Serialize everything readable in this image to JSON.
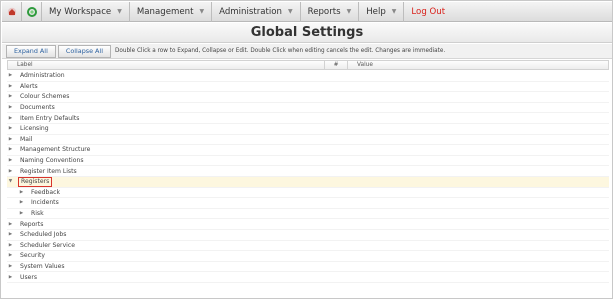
{
  "nav": {
    "items": [
      {
        "label": "My Workspace",
        "dropdown": true
      },
      {
        "label": "Management",
        "dropdown": true
      },
      {
        "label": "Administration",
        "dropdown": true
      },
      {
        "label": "Reports",
        "dropdown": true
      },
      {
        "label": "Help",
        "dropdown": true
      }
    ],
    "logout": "Log Out",
    "logout_color": "#d9211b"
  },
  "page": {
    "title": "Global Settings"
  },
  "toolbar": {
    "expand_label": "Expand All",
    "collapse_label": "Collapse All",
    "help_text": "Double Click a row to Expand, Collapse or Edit. Double Click when editing cancels the edit. Changes are immediate."
  },
  "grid": {
    "columns": [
      "Label",
      "#",
      "Value"
    ],
    "rows": [
      {
        "label": "Administration",
        "expanded": false
      },
      {
        "label": "Alerts",
        "expanded": false
      },
      {
        "label": "Colour Schemes",
        "expanded": false
      },
      {
        "label": "Documents",
        "expanded": false
      },
      {
        "label": "Item Entry Defaults",
        "expanded": false
      },
      {
        "label": "Licensing",
        "expanded": false
      },
      {
        "label": "Mail",
        "expanded": false
      },
      {
        "label": "Management Structure",
        "expanded": false
      },
      {
        "label": "Naming Conventions",
        "expanded": false
      },
      {
        "label": "Register Item Lists",
        "expanded": false
      },
      {
        "label": "Registers",
        "expanded": true,
        "selected": true
      },
      {
        "label": "Feedback",
        "child": true
      },
      {
        "label": "Incidents",
        "child": true
      },
      {
        "label": "Risk",
        "child": true
      },
      {
        "label": "Reports",
        "expanded": false
      },
      {
        "label": "Scheduled Jobs",
        "expanded": false
      },
      {
        "label": "Scheduler Service",
        "expanded": false
      },
      {
        "label": "Security",
        "expanded": false
      },
      {
        "label": "System Values",
        "expanded": false
      },
      {
        "label": "Users",
        "expanded": false
      }
    ]
  }
}
